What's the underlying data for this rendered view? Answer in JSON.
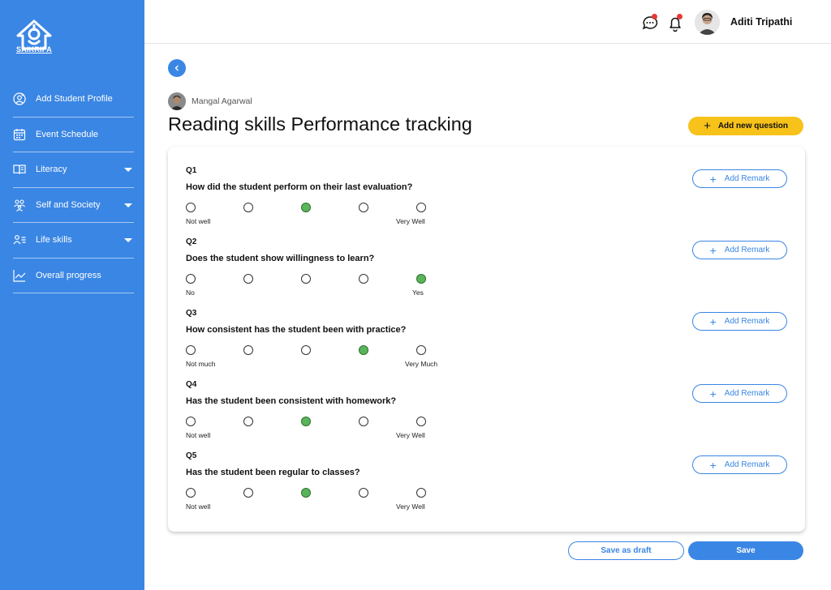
{
  "brand": {
    "logo_text": "SAIKRIPA"
  },
  "sidebar": {
    "items": [
      {
        "label": "Add Student Profile",
        "icon": "user-add-icon",
        "has_caret": false
      },
      {
        "label": "Event Schedule",
        "icon": "calendar-icon",
        "has_caret": false
      },
      {
        "label": "Literacy",
        "icon": "book-icon",
        "has_caret": true
      },
      {
        "label": "Self and Society",
        "icon": "people-icon",
        "has_caret": true
      },
      {
        "label": "Life skills",
        "icon": "user-list-icon",
        "has_caret": true
      },
      {
        "label": "Overall progress",
        "icon": "chart-line-icon",
        "has_caret": false
      }
    ]
  },
  "header": {
    "user_name": "Aditi Tripathi",
    "chat_icon": "chat-icon",
    "bell_icon": "bell-icon"
  },
  "student": {
    "name": "Mangal Agarwal"
  },
  "page": {
    "title": "Reading skills Performance tracking",
    "add_question_label": "Add new question"
  },
  "questions": [
    {
      "num": "Q1",
      "text": "How did the student perform on their last evaluation?",
      "low_label": "Not well",
      "high_label": "Very Well",
      "selected": 3
    },
    {
      "num": "Q2",
      "text": "Does the student show willingness to learn?",
      "low_label": "No",
      "high_label": "Yes",
      "selected": 5
    },
    {
      "num": "Q3",
      "text": "How consistent  has the student been with practice?",
      "low_label": "Not much",
      "high_label": "Very Much",
      "selected": 4
    },
    {
      "num": "Q4",
      "text": "Has the student been consistent with homework?",
      "low_label": "Not well",
      "high_label": "Very Well",
      "selected": 3
    },
    {
      "num": "Q5",
      "text": "Has the student been regular to classes?",
      "low_label": "Not well",
      "high_label": "Very Well",
      "selected": 3
    }
  ],
  "remark_label": "Add Remark",
  "footer": {
    "draft_label": "Save as draft",
    "save_label": "Save"
  },
  "colors": {
    "primary": "#3a86e4",
    "accent": "#f7c21a",
    "selected": "#5ab55a",
    "notification": "#e53935"
  }
}
